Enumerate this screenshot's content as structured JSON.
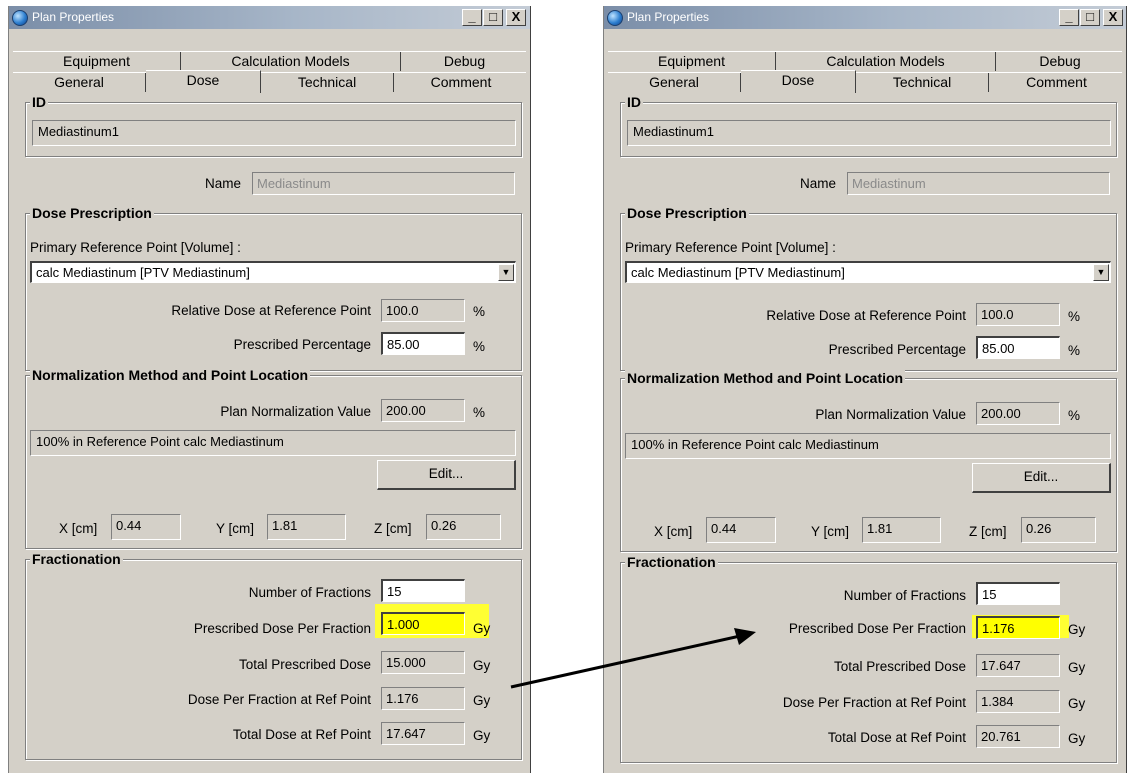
{
  "colors": {
    "highlight": "#ffff00",
    "dialog_bg": "#d4d0c8",
    "arrow": "#000000"
  },
  "left": {
    "title": "Plan Properties",
    "window_buttons": {
      "minimize": "_",
      "maximize": "□",
      "close": "X"
    },
    "tabs_row1": [
      "Equipment",
      "Calculation Models",
      "Debug"
    ],
    "tabs_row2": [
      "General",
      "Dose",
      "Technical",
      "Comment"
    ],
    "id_group": {
      "legend": "ID",
      "value": "Mediastinum1"
    },
    "name_label": "Name",
    "name_value": "Mediastinum",
    "dose_prescription": {
      "legend": "Dose Prescription",
      "primary_ref_label": "Primary Reference Point [Volume] :",
      "primary_ref_value": "calc Mediastinum  [PTV Mediastinum]",
      "relative_dose_label": "Relative Dose at Reference Point",
      "relative_dose_value": "100.0",
      "relative_dose_unit": "%",
      "prescribed_pct_label": "Prescribed Percentage",
      "prescribed_pct_value": "85.00",
      "prescribed_pct_unit": "%"
    },
    "normalization": {
      "legend": "Normalization Method and Point Location",
      "plan_norm_label": "Plan Normalization Value",
      "plan_norm_value": "200.00",
      "plan_norm_unit": "%",
      "method_text": "100% in Reference Point calc Mediastinum",
      "edit_label": "Edit...",
      "x_label": "X [cm]",
      "x_value": "0.44",
      "y_label": "Y [cm]",
      "y_value": "1.81",
      "z_label": "Z [cm]",
      "z_value": "0.26"
    },
    "fractionation": {
      "legend": "Fractionation",
      "num_fractions_label": "Number of Fractions",
      "num_fractions_value": "15",
      "dose_per_fraction_label": "Prescribed Dose Per Fraction",
      "dose_per_fraction_value": "1.000",
      "dose_per_fraction_unit": "Gy",
      "total_prescribed_label": "Total Prescribed Dose",
      "total_prescribed_value": "15.000",
      "total_prescribed_unit": "Gy",
      "dose_per_fraction_ref_label": "Dose Per Fraction at Ref Point",
      "dose_per_fraction_ref_value": "1.176",
      "dose_per_fraction_ref_unit": "Gy",
      "total_dose_ref_label": "Total Dose at Ref Point",
      "total_dose_ref_value": "17.647",
      "total_dose_ref_unit": "Gy"
    }
  },
  "right": {
    "title": "Plan Properties",
    "window_buttons": {
      "minimize": "_",
      "maximize": "□",
      "close": "X"
    },
    "tabs_row1": [
      "Equipment",
      "Calculation Models",
      "Debug"
    ],
    "tabs_row2": [
      "General",
      "Dose",
      "Technical",
      "Comment"
    ],
    "id_group": {
      "legend": "ID",
      "value": "Mediastinum1"
    },
    "name_label": "Name",
    "name_value": "Mediastinum",
    "dose_prescription": {
      "legend": "Dose Prescription",
      "primary_ref_label": "Primary Reference Point [Volume] :",
      "primary_ref_value": "calc Mediastinum  [PTV Mediastinum]",
      "relative_dose_label": "Relative Dose at Reference Point",
      "relative_dose_value": "100.0",
      "relative_dose_unit": "%",
      "prescribed_pct_label": "Prescribed Percentage",
      "prescribed_pct_value": "85.00",
      "prescribed_pct_unit": "%"
    },
    "normalization": {
      "legend": "Normalization Method and Point Location",
      "plan_norm_label": "Plan Normalization Value",
      "plan_norm_value": "200.00",
      "plan_norm_unit": "%",
      "method_text": "100% in Reference Point calc Mediastinum",
      "edit_label": "Edit...",
      "x_label": "X [cm]",
      "x_value": "0.44",
      "y_label": "Y [cm]",
      "y_value": "1.81",
      "z_label": "Z [cm]",
      "z_value": "0.26"
    },
    "fractionation": {
      "legend": "Fractionation",
      "num_fractions_label": "Number of Fractions",
      "num_fractions_value": "15",
      "dose_per_fraction_label": "Prescribed Dose Per Fraction",
      "dose_per_fraction_value": "1.176",
      "dose_per_fraction_unit": "Gy",
      "total_prescribed_label": "Total Prescribed Dose",
      "total_prescribed_value": "17.647",
      "total_prescribed_unit": "Gy",
      "dose_per_fraction_ref_label": "Dose Per Fraction at Ref Point",
      "dose_per_fraction_ref_value": "1.384",
      "dose_per_fraction_ref_unit": "Gy",
      "total_dose_ref_label": "Total Dose at Ref Point",
      "total_dose_ref_value": "20.761",
      "total_dose_ref_unit": "Gy"
    }
  }
}
